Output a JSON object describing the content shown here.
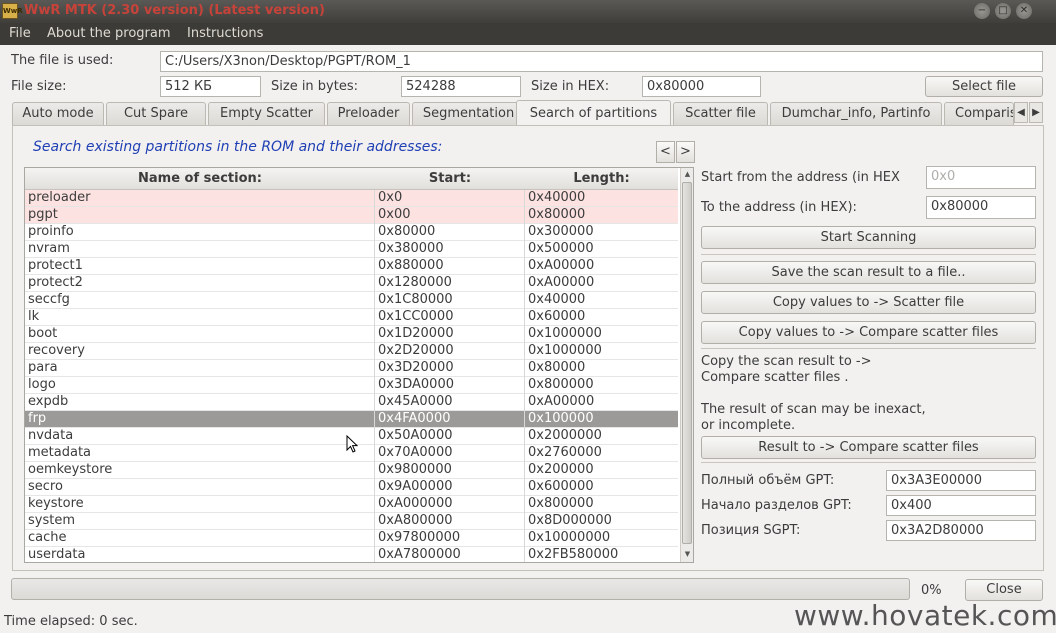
{
  "window": {
    "icon_text": "WwR",
    "title": "WwR MTK (2.30 version) (Latest version)",
    "controls": [
      "−",
      "□",
      "✕"
    ]
  },
  "menu": [
    "File",
    "About the program",
    "Instructions"
  ],
  "file": {
    "used_label": "The file is used:",
    "path": "C:/Users/X3non/Desktop/PGPT/ROM_1",
    "size_label": "File size:",
    "size": "512 КБ",
    "bytes_label": "Size in bytes:",
    "bytes": "524288",
    "hex_label": "Size in HEX:",
    "hex": "0x80000",
    "select_button": "Select file"
  },
  "tabs": [
    {
      "label": "Auto mode"
    },
    {
      "label": "Cut Spare"
    },
    {
      "label": "Empty Scatter"
    },
    {
      "label": "Preloader"
    },
    {
      "label": "Segmentation"
    },
    {
      "label": "Search of partitions"
    },
    {
      "label": "Scatter file"
    },
    {
      "label": "Dumchar_info, Partinfo"
    },
    {
      "label": "Comparis"
    }
  ],
  "tab_arrows": [
    "◀",
    "▶"
  ],
  "search": {
    "heading": "Search existing partitions in the ROM and their addresses:",
    "nav_prev": "<",
    "nav_next": ">",
    "columns": [
      "Name of section:",
      "Start:",
      "Length:"
    ],
    "rows": [
      {
        "name": "preloader",
        "start": "0x0",
        "length": "0x40000"
      },
      {
        "name": "pgpt",
        "start": "0x00",
        "length": "0x80000"
      },
      {
        "name": "proinfo",
        "start": "0x80000",
        "length": "0x300000"
      },
      {
        "name": "nvram",
        "start": "0x380000",
        "length": "0x500000"
      },
      {
        "name": "protect1",
        "start": "0x880000",
        "length": "0xA00000"
      },
      {
        "name": "protect2",
        "start": "0x1280000",
        "length": "0xA00000"
      },
      {
        "name": "seccfg",
        "start": "0x1C80000",
        "length": "0x40000"
      },
      {
        "name": "lk",
        "start": "0x1CC0000",
        "length": "0x60000"
      },
      {
        "name": "boot",
        "start": "0x1D20000",
        "length": "0x1000000"
      },
      {
        "name": "recovery",
        "start": "0x2D20000",
        "length": "0x1000000"
      },
      {
        "name": "para",
        "start": "0x3D20000",
        "length": "0x80000"
      },
      {
        "name": "logo",
        "start": "0x3DA0000",
        "length": "0x800000"
      },
      {
        "name": "expdb",
        "start": "0x45A0000",
        "length": "0xA00000"
      },
      {
        "name": "frp",
        "start": "0x4FA0000",
        "length": "0x100000"
      },
      {
        "name": "nvdata",
        "start": "0x50A0000",
        "length": "0x2000000"
      },
      {
        "name": "metadata",
        "start": "0x70A0000",
        "length": "0x2760000"
      },
      {
        "name": "oemkeystore",
        "start": "0x9800000",
        "length": "0x200000"
      },
      {
        "name": "secro",
        "start": "0x9A00000",
        "length": "0x600000"
      },
      {
        "name": "keystore",
        "start": "0xA000000",
        "length": "0x800000"
      },
      {
        "name": "system",
        "start": "0xA800000",
        "length": "0x8D000000"
      },
      {
        "name": "cache",
        "start": "0x97800000",
        "length": "0x10000000"
      },
      {
        "name": "userdata",
        "start": "0xA7800000",
        "length": "0x2FB580000"
      }
    ],
    "highlighted_rows": [
      0,
      1
    ],
    "selected_row": 13
  },
  "scan": {
    "start_label": "Start from the address (in HEX",
    "start_value": "0x0",
    "end_label": "To the address (in HEX):",
    "end_value": "0x80000",
    "start_button": "Start Scanning",
    "save_button": "Save the scan result to a file..",
    "copy_scatter_button": "Copy values to -> Scatter file",
    "copy_compare_button": "Copy values to -> Compare scatter files",
    "note1_line1": "Copy the scan result to ->",
    "note1_line2": "Compare scatter files .",
    "note2_line1": "The result of scan may be inexact,",
    "note2_line2": "or incomplete.",
    "result_button": "Result to -> Compare scatter files",
    "gpt_total_label": "Полный объём GPT:",
    "gpt_total_value": "0x3A3E00000",
    "gpt_start_label": "Начало разделов GPT:",
    "gpt_start_value": "0x400",
    "sgpt_label": "Позиция SGPT:",
    "sgpt_value": "0x3A2D80000"
  },
  "footer": {
    "progress_percent": "0%",
    "progress_fraction": 0,
    "close_button": "Close",
    "elapsed": "Time elapsed: 0  sec.",
    "watermark": "www.hovatek.com"
  }
}
